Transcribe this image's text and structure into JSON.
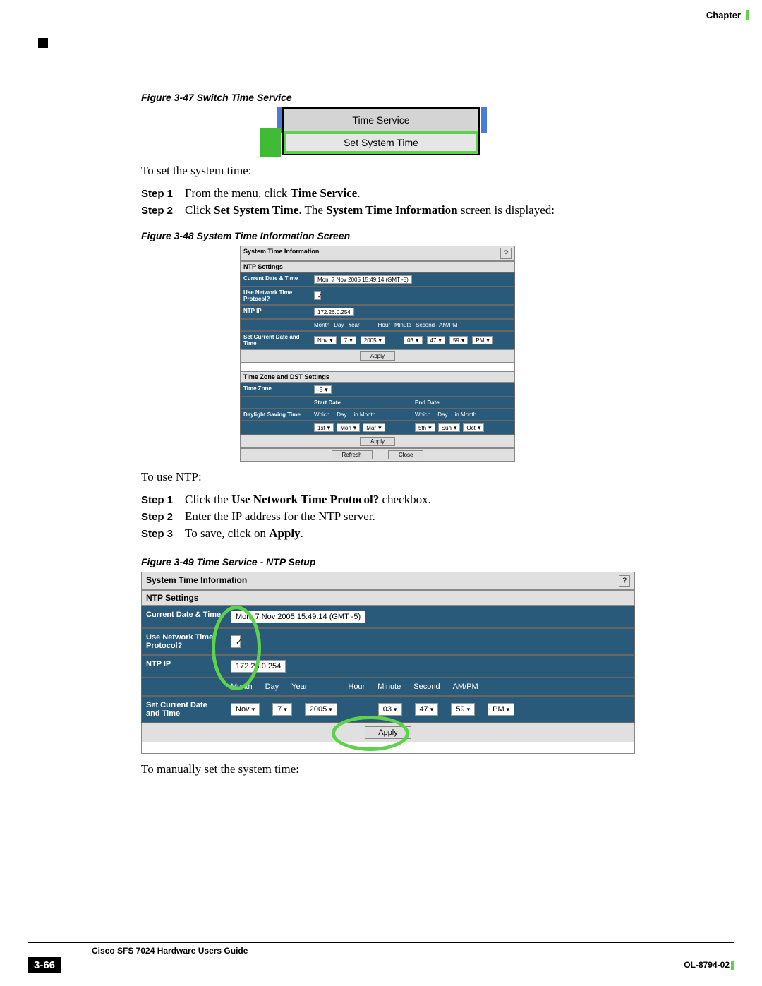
{
  "header": {
    "chapter": "Chapter"
  },
  "fig47": {
    "caption": "Figure 3-47   Switch Time Service",
    "row1": "Time Service",
    "row2": "Set System Time"
  },
  "intro1": "To set the system time:",
  "steps_a": {
    "s1_lbl": "Step 1",
    "s1_pre": "From the menu, click ",
    "s1_bold": "Time Service",
    "s1_post": ".",
    "s2_lbl": "Step 2",
    "s2_pre": "Click ",
    "s2_b1": "Set System Time",
    "s2_mid": ". The ",
    "s2_b2": "System Time Information",
    "s2_post": " screen is displayed:"
  },
  "fig48": {
    "caption": "Figure 3-48   System Time Information Screen",
    "title": "System Time Information",
    "help": "?",
    "sec1": "NTP Settings",
    "r_cur_lbl": "Current Date & Time",
    "r_cur_val": "Mon, 7 Nov 2005 15:49:14  (GMT -5)",
    "r_use_lbl": "Use Network Time Protocol?",
    "r_ip_lbl": "NTP IP",
    "r_ip_val": "172.26.0.254",
    "r_set_lbl": "Set Current Date and Time",
    "hdr": {
      "month": "Month",
      "day": "Day",
      "year": "Year",
      "hour": "Hour",
      "minute": "Minute",
      "second": "Second",
      "ampm": "AM/PM"
    },
    "vals": {
      "month": "Nov",
      "day": "7",
      "year": "2005",
      "hour": "03",
      "minute": "47",
      "second": "59",
      "ampm": "PM"
    },
    "apply": "Apply",
    "sec2": "Time Zone and DST Settings",
    "r_tz_lbl": "Time Zone",
    "r_tz_val": "-5",
    "start_date": "Start Date",
    "end_date": "End Date",
    "r_dst_lbl": "Daylight Saving Time",
    "dst_hdr": {
      "which": "Which",
      "day": "Day",
      "inmonth": "in Month"
    },
    "dst_start": {
      "which": "1st",
      "day": "Mon",
      "inmonth": "Mar"
    },
    "dst_end": {
      "which": "5th",
      "day": "Sun",
      "inmonth": "Oct"
    },
    "refresh": "Refresh",
    "close": "Close"
  },
  "intro2": "To use NTP:",
  "steps_b": {
    "s1_lbl": "Step 1",
    "s1_pre": "Click the ",
    "s1_bold": "Use Network Time Protocol?",
    "s1_post": " checkbox.",
    "s2_lbl": "Step 2",
    "s2_txt": "Enter the IP address for the NTP server.",
    "s3_lbl": "Step 3",
    "s3_pre": "To save, click on ",
    "s3_bold": "Apply",
    "s3_post": "."
  },
  "fig49": {
    "caption": "Figure 3-49   Time Service - NTP Setup",
    "title": "System Time Information",
    "help": "?",
    "sec1": "NTP Settings",
    "r_cur_lbl": "Current Date & Time",
    "r_cur_val": "Mon, 7 Nov 2005 15:49:14  (GMT -5)",
    "r_use_lbl": "Use Network Time Protocol?",
    "r_ip_lbl": "NTP IP",
    "r_ip_val": "172.26.0.254",
    "r_set_lbl": "Set Current Date and Time",
    "hdr": {
      "month": "Month",
      "day": "Day",
      "year": "Year",
      "hour": "Hour",
      "minute": "Minute",
      "second": "Second",
      "ampm": "AM/PM"
    },
    "vals": {
      "month": "Nov",
      "day": "7",
      "year": "2005",
      "hour": "03",
      "minute": "47",
      "second": "59",
      "ampm": "PM"
    },
    "apply": "Apply"
  },
  "intro3": "To manually set the system time:",
  "footer": {
    "guide": "Cisco SFS 7024 Hardware Users Guide",
    "pagenum": "3-66",
    "doc": "OL-8794-02"
  }
}
